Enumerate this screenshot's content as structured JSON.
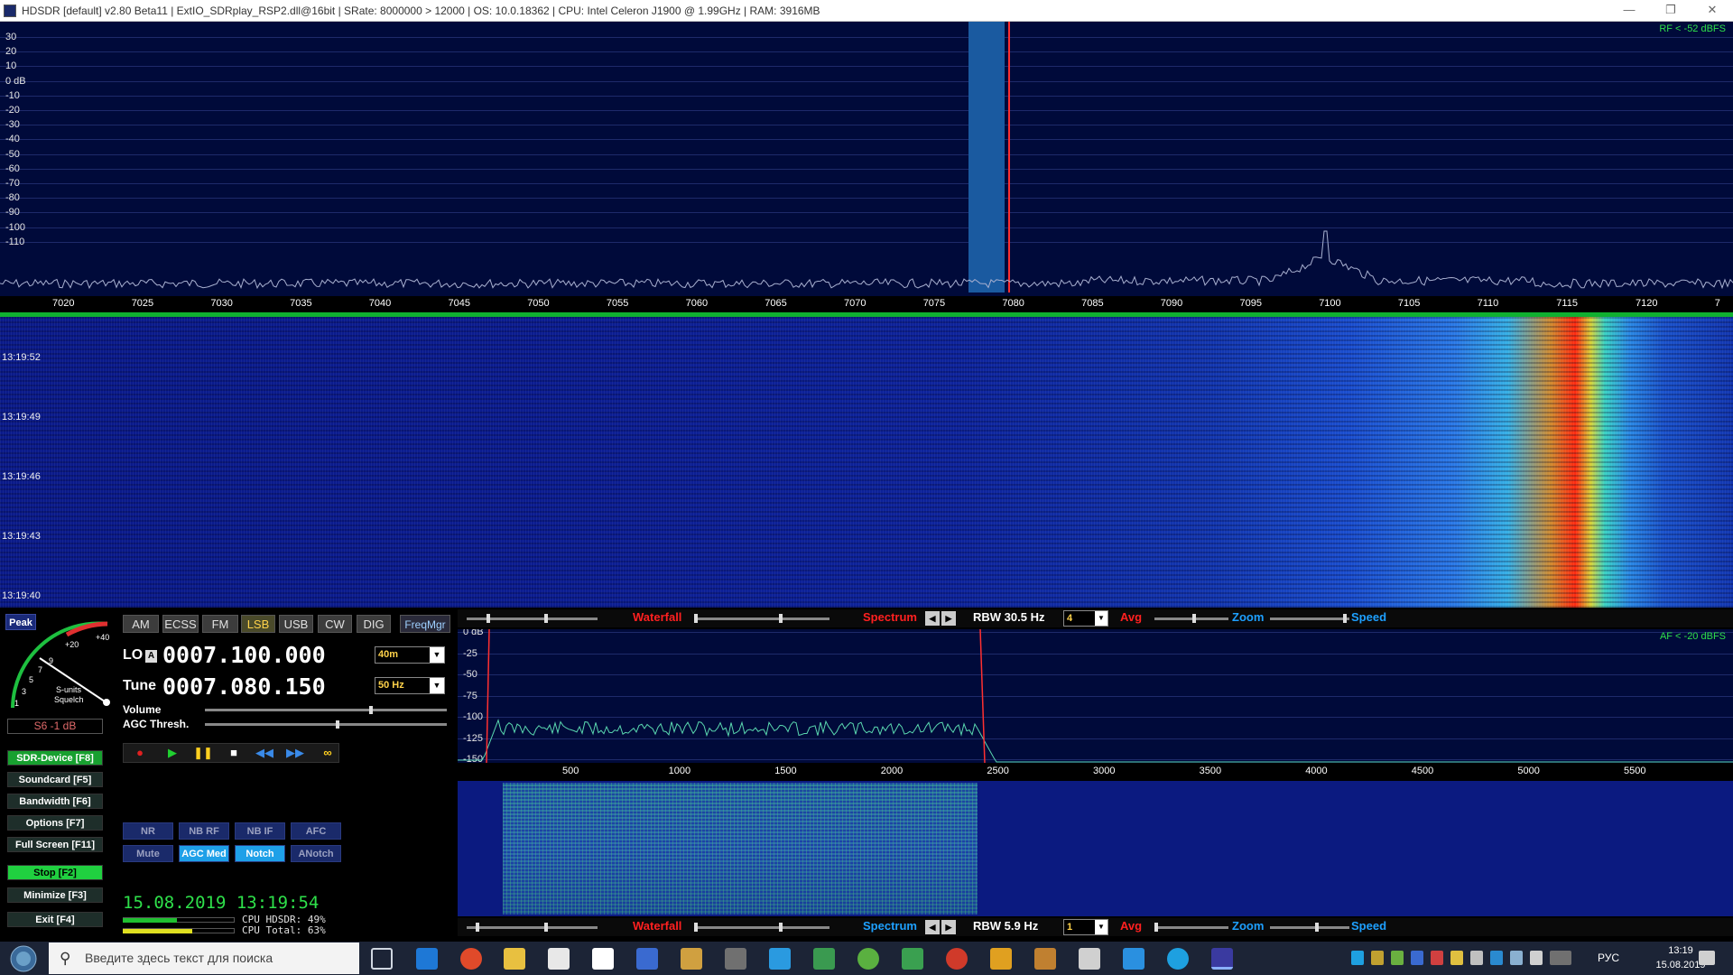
{
  "window": {
    "title": "HDSDR  [default]  v2.80 Beta11  |  ExtIO_SDRplay_RSP2.dll@16bit  |  SRate: 8000000 > 12000  |  OS: 10.0.18362   |  CPU: Intel Celeron  J1900  @ 1.99GHz  |  RAM: 3916MB",
    "minimize": "—",
    "restore": "❐",
    "close": "✕"
  },
  "rf_spectrum": {
    "label": "RF < -52 dBFS",
    "db_labels": [
      "30",
      "20",
      "10",
      "0 dB",
      "-10",
      "-20",
      "-30",
      "-40",
      "-50",
      "-60",
      "-70",
      "-80",
      "-90",
      "-100",
      "-110"
    ],
    "freq_labels": [
      "7020",
      "7025",
      "7030",
      "7035",
      "7040",
      "7045",
      "7050",
      "7055",
      "7060",
      "7065",
      "7070",
      "7075",
      "7080",
      "7085",
      "7090",
      "7095",
      "7100",
      "7105",
      "7110",
      "7115",
      "7120",
      "7"
    ],
    "colors": {
      "background": "#000a3a",
      "trace": "#a8b0d0",
      "filter_band": "#1a5aa0",
      "tune_line": "#ff3030"
    }
  },
  "rf_waterfall": {
    "timestamps": [
      "13:19:52",
      "13:19:49",
      "13:19:46",
      "13:19:43",
      "13:19:40"
    ]
  },
  "smeter": {
    "peak_label": "Peak",
    "scale_red": [
      "+40",
      "+20"
    ],
    "scale_white": [
      "9",
      "7",
      "5",
      "3",
      "1"
    ],
    "units": "S-units",
    "squelch": "Squelch",
    "reading": "S6 -1 dB"
  },
  "modes": {
    "buttons": [
      "AM",
      "ECSS",
      "FM",
      "LSB",
      "USB",
      "CW",
      "DIG"
    ],
    "active": "LSB",
    "freqmgr": "FreqMgr"
  },
  "lo": {
    "label": "LO",
    "vfo": "A",
    "freq": "0007.100.000",
    "band": "40m"
  },
  "tune": {
    "label": "Tune",
    "freq": "0007.080.150",
    "step": "50 Hz"
  },
  "sliders": {
    "volume_label": "Volume",
    "agc_label": "AGC Thresh.",
    "volume_level": 0.68,
    "agc_level": 0.54
  },
  "function_keys": [
    "SDR-Device [F8]",
    "Soundcard  [F5]",
    "Bandwidth  [F6]",
    "Options   [F7]",
    "Full Screen [F11]",
    "Stop      [F2]",
    "Minimize  [F3]",
    "Exit      [F4]"
  ],
  "dsp": {
    "row1": [
      "NR",
      "NB RF",
      "NB IF",
      "AFC"
    ],
    "row2": [
      "Mute",
      "AGC Med",
      "Notch",
      "ANotch"
    ]
  },
  "status": {
    "datetime": "15.08.2019 13:19:54",
    "cpu_hdsdr": "CPU HDSDR: 49%",
    "cpu_total": "CPU Total: 63%",
    "cpu_hdsdr_level": 0.49,
    "cpu_total_level": 0.63
  },
  "rf_controls": {
    "waterfall": "Waterfall",
    "spectrum": "Spectrum",
    "rbw": "RBW 30.5 Hz",
    "avg_value": "4",
    "avg": "Avg",
    "zoom": "Zoom",
    "speed": "Speed"
  },
  "af_spectrum": {
    "label": "AF < -20 dBFS",
    "db_labels": [
      "0 dB",
      "-25",
      "-50",
      "-75",
      "-100",
      "-125",
      "-150"
    ],
    "freq_labels": [
      "500",
      "1000",
      "1500",
      "2000",
      "2500",
      "3000",
      "3500",
      "4000",
      "4500",
      "5000",
      "5500"
    ]
  },
  "af_controls": {
    "waterfall": "Waterfall",
    "spectrum": "Spectrum",
    "rbw": "RBW  5.9 Hz",
    "avg_value": "1",
    "avg": "Avg",
    "zoom": "Zoom",
    "speed": "Speed"
  },
  "taskbar": {
    "search_placeholder": "Введите здесь текст для поиска",
    "lang": "РУС",
    "time": "13:19",
    "date": "15.08.2019"
  }
}
